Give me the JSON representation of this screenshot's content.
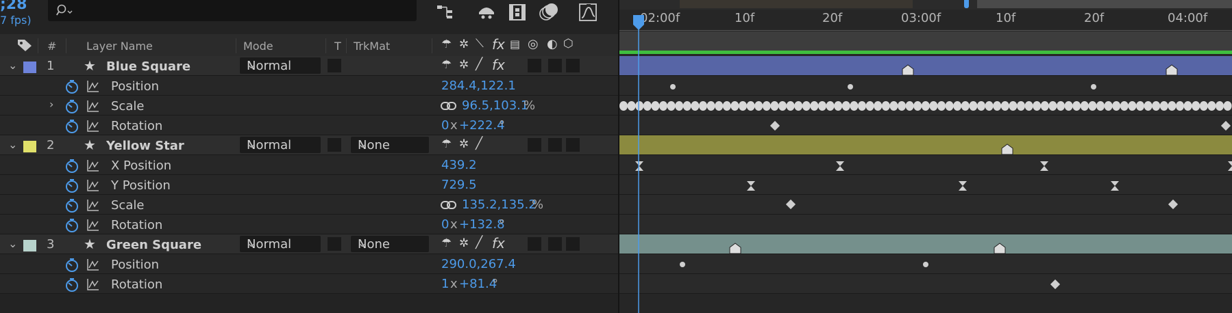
{
  "composition": {
    "timecode": ";28",
    "fps": "7 fps)"
  },
  "search": {
    "placeholder": ""
  },
  "columns": {
    "number": "#",
    "layer_name": "Layer Name",
    "mode": "Mode",
    "t": "T",
    "trkmat": "TrkMat"
  },
  "timeline": {
    "ruler_labels": [
      "02:00f",
      "10f",
      "20f",
      "03:00f",
      "10f",
      "20f",
      "04:00f"
    ],
    "bar_colors": {
      "blue_square": "#5765a6",
      "yellow_star": "#8b8a3f",
      "green_square": "#75908c"
    },
    "playhead_color": "#4d9bea",
    "work_area_color": "#3fbf3f"
  },
  "layers": [
    {
      "number": "1",
      "name": "Blue Square",
      "color": "#6e83db",
      "mode": "Normal",
      "trkmat": "",
      "properties": [
        {
          "name": "Position",
          "value": "284.4,122.1",
          "unit": ""
        },
        {
          "name": "Scale",
          "value": "96.5,103.1",
          "unit": "%"
        },
        {
          "name": "Rotation",
          "value_count": "0",
          "value_x": "x",
          "value_deg": "+222.4",
          "unit": "°"
        }
      ]
    },
    {
      "number": "2",
      "name": "Yellow Star",
      "color": "#e0e06a",
      "mode": "Normal",
      "trkmat": "None",
      "properties": [
        {
          "name": "X Position",
          "value": "439.2",
          "unit": ""
        },
        {
          "name": "Y Position",
          "value": "729.5",
          "unit": ""
        },
        {
          "name": "Scale",
          "value": "135.2,135.2",
          "unit": "%"
        },
        {
          "name": "Rotation",
          "value_count": "0",
          "value_x": "x",
          "value_deg": "+132.8",
          "unit": "°"
        }
      ]
    },
    {
      "number": "3",
      "name": "Green Square",
      "color": "#b7d3cc",
      "mode": "Normal",
      "trkmat": "None",
      "properties": [
        {
          "name": "Position",
          "value": "290.0,267.4",
          "unit": ""
        },
        {
          "name": "Rotation",
          "value_count": "1",
          "value_x": "x",
          "value_deg": "+81.4",
          "unit": "°"
        }
      ]
    }
  ]
}
